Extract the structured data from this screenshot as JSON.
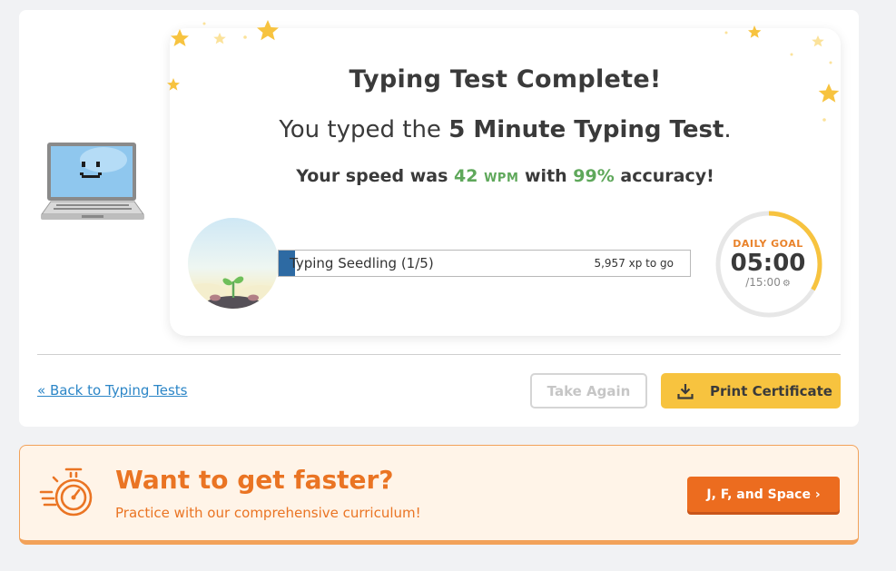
{
  "result": {
    "title": "Typing Test Complete!",
    "subtitle_prefix": "You typed the ",
    "subtitle_test": "5 Minute Typing Test",
    "subtitle_suffix": ".",
    "speed_prefix": "Your speed was ",
    "wpm_value": "42",
    "wpm_unit": "WPM",
    "speed_mid": " with ",
    "accuracy": "99%",
    "speed_suffix": " accuracy!"
  },
  "rank": {
    "label": "Typing Seedling (1/5)",
    "xp_to_go": "5,957 xp to go",
    "progress": 0.04
  },
  "daily_goal": {
    "title": "DAILY GOAL",
    "time": "05:00",
    "target": "/15:00",
    "progress": 0.333
  },
  "actions": {
    "back_label": "« Back to Typing Tests",
    "take_again_label": "Take Again",
    "print_label": "Print Certificate"
  },
  "promo": {
    "title": "Want to get faster?",
    "subtitle": "Practice with our comprehensive curriculum!",
    "button_label": "J, F, and Space ›"
  },
  "colors": {
    "accent_green": "#5fa85b",
    "progress_blue": "#2d6aa3",
    "goal_yellow": "#f7c33f",
    "promo_orange": "#ec6c1f"
  }
}
